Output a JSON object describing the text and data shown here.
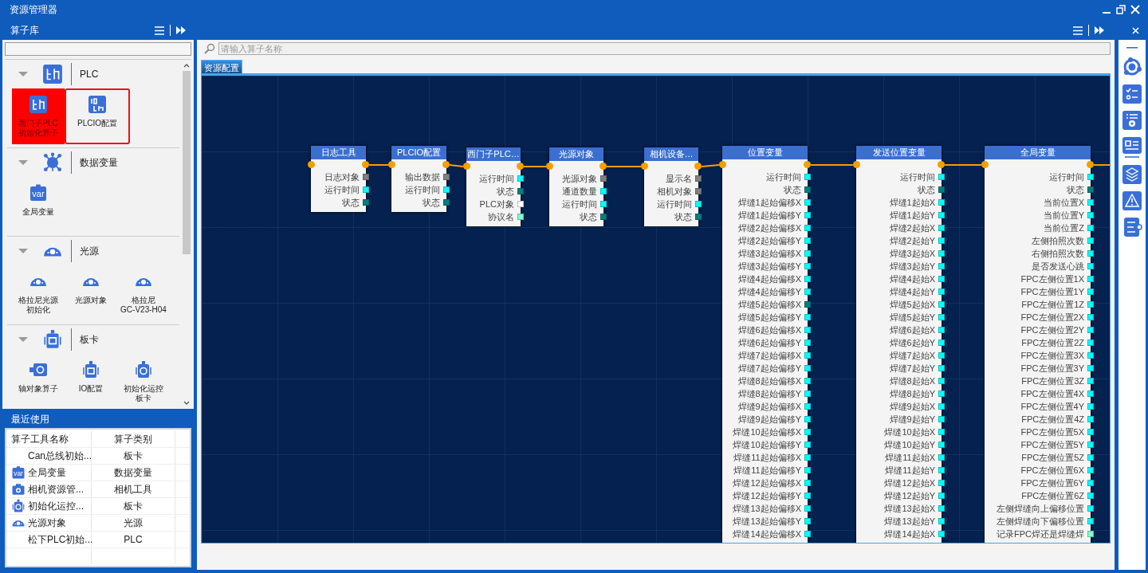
{
  "window": {
    "title": "资源管理器"
  },
  "library": {
    "title": "算子库",
    "categories": [
      {
        "kind": "plc",
        "title": "PLC",
        "expanded": true,
        "items": [
          {
            "kind": "plc",
            "label": "西门子PLC初始化算子",
            "selected": true,
            "highlighted": false
          },
          {
            "kind": "plcio",
            "label": "PLCIO配置",
            "selected": false,
            "highlighted": true
          }
        ]
      },
      {
        "kind": "data",
        "title": "数据变量",
        "expanded": true,
        "items": [
          {
            "kind": "var",
            "icon_text": "var",
            "label": "全局变量",
            "selected": false,
            "highlighted": false
          }
        ]
      },
      {
        "kind": "light",
        "title": "光源",
        "expanded": true,
        "items": [
          {
            "kind": "light",
            "label": "格拉尼光源初始化",
            "selected": false,
            "highlighted": false
          },
          {
            "kind": "light",
            "label": "光源对象",
            "selected": false,
            "highlighted": false
          },
          {
            "kind": "light",
            "label": "格拉尼\nGC-V23-H04",
            "selected": false,
            "highlighted": false
          }
        ]
      },
      {
        "kind": "board",
        "title": "板卡",
        "expanded": true,
        "items": [
          {
            "kind": "axis",
            "label": "轴对象算子",
            "selected": false,
            "highlighted": false
          },
          {
            "kind": "io",
            "label": "IO配置",
            "selected": false,
            "highlighted": false
          },
          {
            "kind": "motion",
            "label": "初始化运控板卡",
            "selected": false,
            "highlighted": false
          }
        ]
      }
    ]
  },
  "recent": {
    "title": "最近使用",
    "columns": [
      "算子工具名称",
      "算子类别"
    ],
    "rows": [
      {
        "kind": "none",
        "name": "Can总线初始...",
        "category": "板卡"
      },
      {
        "kind": "var",
        "icon_text": "var",
        "name": "全局变量",
        "category": "数据变量"
      },
      {
        "kind": "camera",
        "name": "相机资源管...",
        "category": "相机工具"
      },
      {
        "kind": "motion",
        "name": "初始化运控...",
        "category": "板卡"
      },
      {
        "kind": "light",
        "name": "光源对象",
        "category": "光源"
      },
      {
        "kind": "none",
        "name": "松下PLC初始...",
        "category": "PLC"
      }
    ]
  },
  "editor": {
    "search": {
      "placeholder": "请输入算子名称"
    },
    "tabs": [
      {
        "label": "资源配置",
        "selected": true
      }
    ],
    "nodes": [
      {
        "title": "日志工具",
        "ports": [
          {
            "label": "日志对象",
            "color": "#808080"
          },
          {
            "label": "运行时间",
            "color": "#00ffff"
          },
          {
            "label": "状态",
            "color": "#008080"
          }
        ]
      },
      {
        "title": "PLCIO配置",
        "ports": [
          {
            "label": "输出数据",
            "color": "#808080"
          },
          {
            "label": "运行时间",
            "color": "#00ffff"
          },
          {
            "label": "状态",
            "color": "#008080"
          }
        ]
      },
      {
        "title": "西门子PLC…",
        "ports": [
          {
            "label": "运行时间",
            "color": "#00ffff"
          },
          {
            "label": "状态",
            "color": "#008080"
          },
          {
            "label": "PLC对象",
            "color": "#ffffff"
          },
          {
            "label": "协议名",
            "color": "#7fffd4"
          }
        ]
      },
      {
        "title": "光源对象",
        "ports": [
          {
            "label": "光源对象",
            "color": "#808080"
          },
          {
            "label": "通道数量",
            "color": "#00ffff"
          },
          {
            "label": "运行时间",
            "color": "#00ffff"
          },
          {
            "label": "状态",
            "color": "#008080"
          }
        ]
      },
      {
        "title": "相机设备…",
        "ports": [
          {
            "label": "显示名",
            "color": "#808080"
          },
          {
            "label": "相机对象",
            "color": "#808080"
          },
          {
            "label": "运行时间",
            "color": "#00ffff"
          },
          {
            "label": "状态",
            "color": "#008080"
          }
        ]
      },
      {
        "title": "位置变量",
        "ports": [
          {
            "label": "运行时间",
            "color": "#00ffff"
          },
          {
            "label": "状态",
            "color": "#008080"
          },
          {
            "label": "焊缝1起始偏移X",
            "color": "#00ffff"
          },
          {
            "label": "焊缝1起始偏移Y",
            "color": "#00ffff"
          },
          {
            "label": "焊缝2起始偏移X",
            "color": "#00ffff"
          },
          {
            "label": "焊缝2起始偏移Y",
            "color": "#00ffff"
          },
          {
            "label": "焊缝3起始偏移X",
            "color": "#00ffff"
          },
          {
            "label": "焊缝3起始偏移Y",
            "color": "#00ffff"
          },
          {
            "label": "焊缝4起始偏移X",
            "color": "#00ffff"
          },
          {
            "label": "焊缝4起始偏移Y",
            "color": "#00ffff"
          },
          {
            "label": "焊缝5起始偏移X",
            "color": "#008080"
          },
          {
            "label": "焊缝5起始偏移Y",
            "color": "#00ffff"
          },
          {
            "label": "焊缝6起始偏移X",
            "color": "#00ffff"
          },
          {
            "label": "焊缝6起始偏移Y",
            "color": "#00ffff"
          },
          {
            "label": "焊缝7起始偏移X",
            "color": "#00ffff"
          },
          {
            "label": "焊缝7起始偏移Y",
            "color": "#00ffff"
          },
          {
            "label": "焊缝8起始偏移X",
            "color": "#00ffff"
          },
          {
            "label": "焊缝8起始偏移Y",
            "color": "#00ffff"
          },
          {
            "label": "焊缝9起始偏移X",
            "color": "#00ffff"
          },
          {
            "label": "焊缝9起始偏移Y",
            "color": "#00ffff"
          },
          {
            "label": "焊缝10起始偏移X",
            "color": "#00ffff"
          },
          {
            "label": "焊缝10起始偏移Y",
            "color": "#00ffff"
          },
          {
            "label": "焊缝11起始偏移X",
            "color": "#00ffff"
          },
          {
            "label": "焊缝11起始偏移Y",
            "color": "#00ffff"
          },
          {
            "label": "焊缝12起始偏移X",
            "color": "#00ffff"
          },
          {
            "label": "焊缝12起始偏移Y",
            "color": "#00ffff"
          },
          {
            "label": "焊缝13起始偏移X",
            "color": "#00ffff"
          },
          {
            "label": "焊缝13起始偏移Y",
            "color": "#00ffff"
          },
          {
            "label": "焊缝14起始偏移X",
            "color": "#00ffff"
          }
        ]
      },
      {
        "title": "发送位置变量",
        "ports": [
          {
            "label": "运行时间",
            "color": "#00ffff"
          },
          {
            "label": "状态",
            "color": "#008080"
          },
          {
            "label": "焊缝1起始X",
            "color": "#00ffff"
          },
          {
            "label": "焊缝1起始Y",
            "color": "#00ffff"
          },
          {
            "label": "焊缝2起始X",
            "color": "#00ffff"
          },
          {
            "label": "焊缝2起始Y",
            "color": "#00ffff"
          },
          {
            "label": "焊缝3起始X",
            "color": "#00ffff"
          },
          {
            "label": "焊缝3起始Y",
            "color": "#00ffff"
          },
          {
            "label": "焊缝4起始X",
            "color": "#00ffff"
          },
          {
            "label": "焊缝4起始Y",
            "color": "#00ffff"
          },
          {
            "label": "焊缝5起始X",
            "color": "#00ffff"
          },
          {
            "label": "焊缝5起始Y",
            "color": "#00ffff"
          },
          {
            "label": "焊缝6起始X",
            "color": "#00ffff"
          },
          {
            "label": "焊缝6起始Y",
            "color": "#00ffff"
          },
          {
            "label": "焊缝7起始X",
            "color": "#00ffff"
          },
          {
            "label": "焊缝7起始Y",
            "color": "#00ffff"
          },
          {
            "label": "焊缝8起始X",
            "color": "#00ffff"
          },
          {
            "label": "焊缝8起始Y",
            "color": "#00ffff"
          },
          {
            "label": "焊缝9起始X",
            "color": "#00ffff"
          },
          {
            "label": "焊缝9起始Y",
            "color": "#00ffff"
          },
          {
            "label": "焊缝10起始X",
            "color": "#00ffff"
          },
          {
            "label": "焊缝10起始Y",
            "color": "#00ffff"
          },
          {
            "label": "焊缝11起始X",
            "color": "#00ffff"
          },
          {
            "label": "焊缝11起始Y",
            "color": "#00ffff"
          },
          {
            "label": "焊缝12起始X",
            "color": "#00ffff"
          },
          {
            "label": "焊缝12起始Y",
            "color": "#00ffff"
          },
          {
            "label": "焊缝13起始X",
            "color": "#00ffff"
          },
          {
            "label": "焊缝13起始Y",
            "color": "#00ffff"
          },
          {
            "label": "焊缝14起始X",
            "color": "#00ffff"
          }
        ]
      },
      {
        "title": "全局变量",
        "ports": [
          {
            "label": "运行时间",
            "color": "#00ffff"
          },
          {
            "label": "状态",
            "color": "#008080"
          },
          {
            "label": "当前位置X",
            "color": "#00ffff"
          },
          {
            "label": "当前位置Y",
            "color": "#00ffff"
          },
          {
            "label": "当前位置Z",
            "color": "#00ffff"
          },
          {
            "label": "左侧拍照次数",
            "color": "#00ffff"
          },
          {
            "label": "右侧拍照次数",
            "color": "#00ffff"
          },
          {
            "label": "是否发送心跳",
            "color": "#00ffff"
          },
          {
            "label": "FPC左侧位置1X",
            "color": "#00ffff"
          },
          {
            "label": "FPC左侧位置1Y",
            "color": "#00ffff"
          },
          {
            "label": "FPC左侧位置1Z",
            "color": "#00ffff"
          },
          {
            "label": "FPC左侧位置2X",
            "color": "#00ffff"
          },
          {
            "label": "FPC左侧位置2Y",
            "color": "#00ffff"
          },
          {
            "label": "FPC左侧位置2Z",
            "color": "#00ffff"
          },
          {
            "label": "FPC左侧位置3X",
            "color": "#00ffff"
          },
          {
            "label": "FPC左侧位置3Y",
            "color": "#00ffff"
          },
          {
            "label": "FPC左侧位置3Z",
            "color": "#00ffff"
          },
          {
            "label": "FPC左侧位置4X",
            "color": "#00ffff"
          },
          {
            "label": "FPC左侧位置4Y",
            "color": "#00ffff"
          },
          {
            "label": "FPC左侧位置4Z",
            "color": "#00ffff"
          },
          {
            "label": "FPC左侧位置5X",
            "color": "#00ffff"
          },
          {
            "label": "FPC左侧位置5Y",
            "color": "#00ffff"
          },
          {
            "label": "FPC左侧位置5Z",
            "color": "#00ffff"
          },
          {
            "label": "FPC左侧位置6X",
            "color": "#00ffff"
          },
          {
            "label": "FPC左侧位置6Y",
            "color": "#00ffff"
          },
          {
            "label": "FPC左侧位置6Z",
            "color": "#00ffff"
          },
          {
            "label": "左侧焊缝向上偏移位置",
            "color": "#00ffff"
          },
          {
            "label": "左侧焊缝向下偏移位置",
            "color": "#00ffff"
          },
          {
            "label": "记录FPC焊还是焊缝焊",
            "color": "#7fffd4"
          }
        ]
      }
    ]
  }
}
